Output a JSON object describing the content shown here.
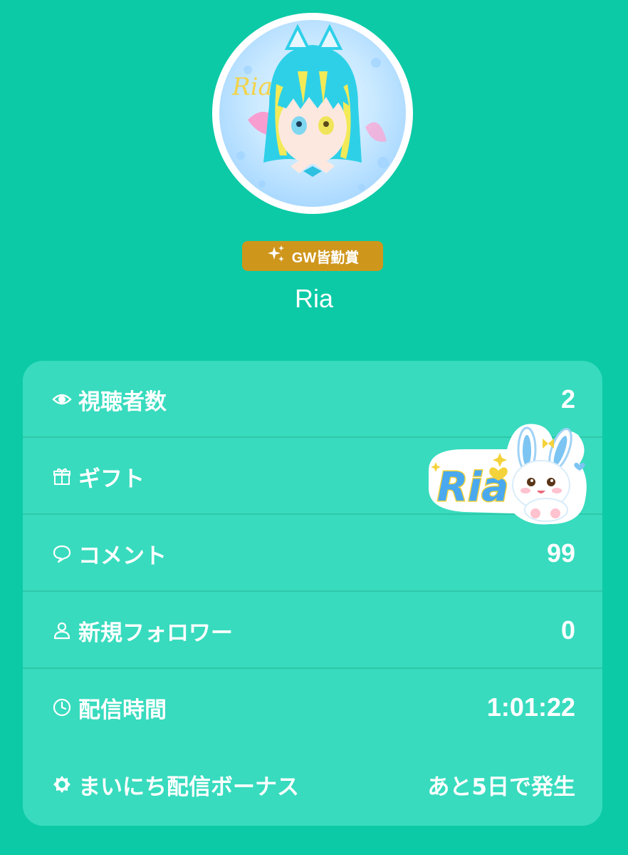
{
  "profile": {
    "badge_label": "GW皆勤賞",
    "username": "Ria",
    "avatar_text": "Ria"
  },
  "stats": [
    {
      "icon": "eye-icon",
      "label": "視聴者数",
      "value": "2"
    },
    {
      "icon": "gift-icon",
      "label": "ギフト",
      "value": ""
    },
    {
      "icon": "comment-icon",
      "label": "コメント",
      "value": "99"
    },
    {
      "icon": "person-icon",
      "label": "新規フォロワー",
      "value": "0"
    },
    {
      "icon": "clock-icon",
      "label": "配信時間",
      "value": "1:01:22"
    },
    {
      "icon": "sun-icon",
      "label": "まいにち配信ボーナス",
      "value": "あと5日で発生"
    }
  ],
  "sticker": {
    "text": "Ria"
  },
  "colors": {
    "background": "#0ccaa6",
    "card": "#38dbbe",
    "badge": "#cf961c"
  }
}
